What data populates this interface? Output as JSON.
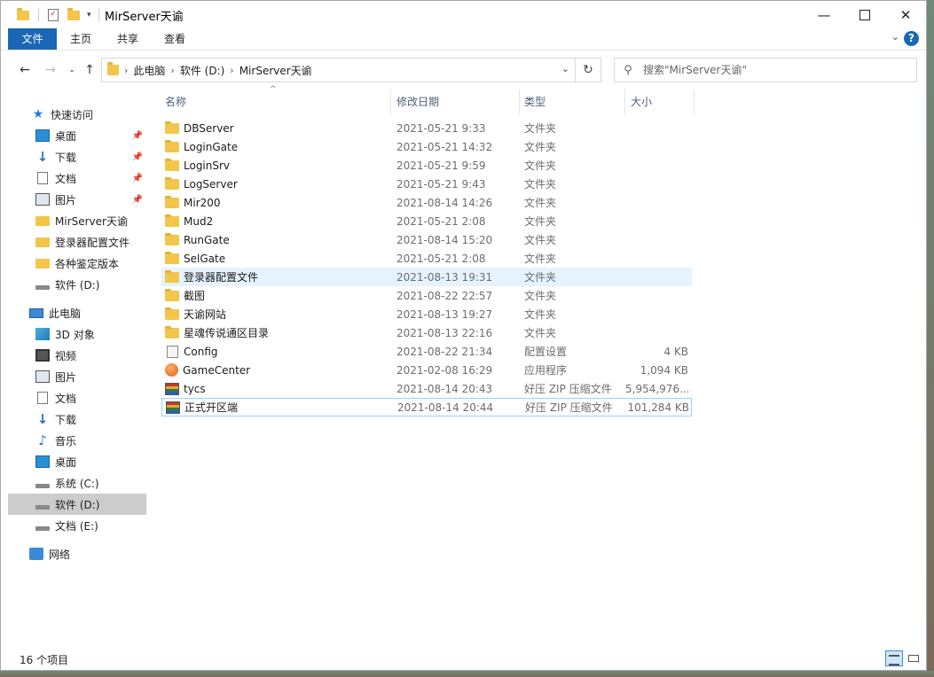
{
  "window": {
    "title": "MirServer天谕"
  },
  "ribbon": {
    "tabs": [
      "文件",
      "主页",
      "共享",
      "查看"
    ],
    "help_label": "?"
  },
  "nav": {
    "breadcrumb": [
      "此电脑",
      "软件 (D:)",
      "MirServer天谕"
    ],
    "search_placeholder": "搜索\"MirServer天谕\""
  },
  "sidebar": {
    "items": [
      {
        "label": "快速访问",
        "icon": "star-icon"
      },
      {
        "label": "桌面",
        "icon": "desktop-icon",
        "pinned": true
      },
      {
        "label": "下载",
        "icon": "download-icon",
        "pinned": true
      },
      {
        "label": "文档",
        "icon": "document-icon",
        "pinned": true
      },
      {
        "label": "图片",
        "icon": "pictures-icon",
        "pinned": true
      },
      {
        "label": "MirServer天谕",
        "icon": "folder-icon"
      },
      {
        "label": "登录器配置文件",
        "icon": "folder-icon"
      },
      {
        "label": "各种鉴定版本",
        "icon": "folder-icon"
      },
      {
        "label": "软件 (D:)",
        "icon": "drive-icon"
      },
      {
        "label": "此电脑",
        "icon": "computer-icon"
      },
      {
        "label": "3D 对象",
        "icon": "3d-objects-icon"
      },
      {
        "label": "视频",
        "icon": "video-icon"
      },
      {
        "label": "图片",
        "icon": "pictures-icon"
      },
      {
        "label": "文档",
        "icon": "document-icon"
      },
      {
        "label": "下载",
        "icon": "download-icon"
      },
      {
        "label": "音乐",
        "icon": "music-icon"
      },
      {
        "label": "桌面",
        "icon": "desktop-icon"
      },
      {
        "label": "系统 (C:)",
        "icon": "drive-icon"
      },
      {
        "label": "软件 (D:)",
        "icon": "drive-icon",
        "selected": true
      },
      {
        "label": "文档 (E:)",
        "icon": "drive-icon"
      },
      {
        "label": "网络",
        "icon": "network-icon"
      }
    ]
  },
  "columns": {
    "name": "名称",
    "date": "修改日期",
    "type": "类型",
    "size": "大小"
  },
  "files": [
    {
      "name": "DBServer",
      "date": "2021-05-21 9:33",
      "type": "文件夹",
      "size": "",
      "icon": "folder"
    },
    {
      "name": "LoginGate",
      "date": "2021-05-21 14:32",
      "type": "文件夹",
      "size": "",
      "icon": "folder"
    },
    {
      "name": "LoginSrv",
      "date": "2021-05-21 9:59",
      "type": "文件夹",
      "size": "",
      "icon": "folder"
    },
    {
      "name": "LogServer",
      "date": "2021-05-21 9:43",
      "type": "文件夹",
      "size": "",
      "icon": "folder"
    },
    {
      "name": "Mir200",
      "date": "2021-08-14 14:26",
      "type": "文件夹",
      "size": "",
      "icon": "folder"
    },
    {
      "name": "Mud2",
      "date": "2021-05-21 2:08",
      "type": "文件夹",
      "size": "",
      "icon": "folder"
    },
    {
      "name": "RunGate",
      "date": "2021-08-14 15:20",
      "type": "文件夹",
      "size": "",
      "icon": "folder"
    },
    {
      "name": "SelGate",
      "date": "2021-05-21 2:08",
      "type": "文件夹",
      "size": "",
      "icon": "folder"
    },
    {
      "name": "登录器配置文件",
      "date": "2021-08-13 19:31",
      "type": "文件夹",
      "size": "",
      "icon": "folder",
      "state": "hover"
    },
    {
      "name": "截图",
      "date": "2021-08-22 22:57",
      "type": "文件夹",
      "size": "",
      "icon": "folder"
    },
    {
      "name": "天谕网站",
      "date": "2021-08-13 19:27",
      "type": "文件夹",
      "size": "",
      "icon": "folder"
    },
    {
      "name": "星魂传说通区目录",
      "date": "2021-08-13 22:16",
      "type": "文件夹",
      "size": "",
      "icon": "folder"
    },
    {
      "name": "Config",
      "date": "2021-08-22 21:34",
      "type": "配置设置",
      "size": "4 KB",
      "icon": "config"
    },
    {
      "name": "GameCenter",
      "date": "2021-02-08 16:29",
      "type": "应用程序",
      "size": "1,094 KB",
      "icon": "app"
    },
    {
      "name": "tycs",
      "date": "2021-08-14 20:43",
      "type": "好压 ZIP 压缩文件",
      "size": "5,954,976...",
      "icon": "zip"
    },
    {
      "name": "正式开区端",
      "date": "2021-08-14 20:44",
      "type": "好压 ZIP 压缩文件",
      "size": "101,284 KB",
      "icon": "zip",
      "state": "focused"
    }
  ],
  "status": {
    "item_count": "16 个项目"
  }
}
